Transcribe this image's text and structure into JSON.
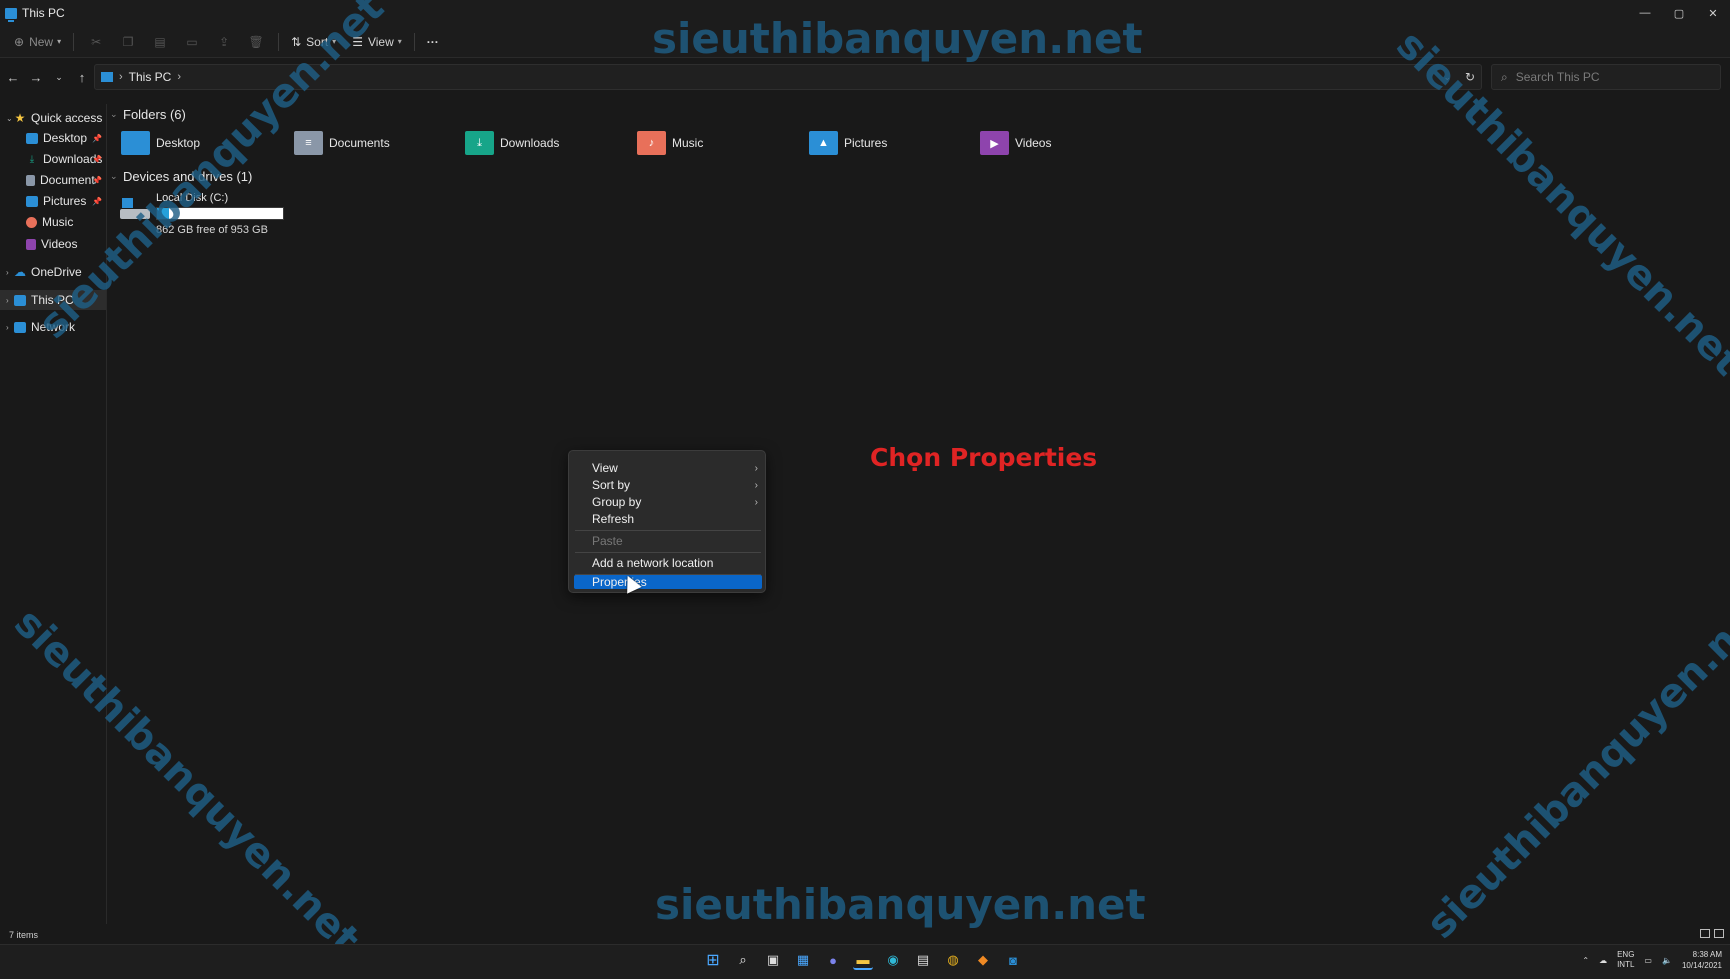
{
  "window": {
    "title": "This PC",
    "controls": {
      "minimize": "—",
      "maximize": "▢",
      "close": "✕"
    }
  },
  "commandbar": {
    "new_label": "New",
    "sort_label": "Sort",
    "view_label": "View",
    "more_label": "···"
  },
  "address": {
    "crumb": "This PC",
    "search_placeholder": "Search This PC"
  },
  "sidebar": {
    "quick_access": "Quick access",
    "items": [
      {
        "label": "Desktop",
        "icon": "desktop-icon",
        "pinned": true
      },
      {
        "label": "Downloads",
        "icon": "downloads-icon",
        "pinned": true
      },
      {
        "label": "Documents",
        "icon": "documents-icon",
        "pinned": true
      },
      {
        "label": "Pictures",
        "icon": "pictures-icon",
        "pinned": true
      },
      {
        "label": "Music",
        "icon": "music-icon",
        "pinned": false
      },
      {
        "label": "Videos",
        "icon": "videos-icon",
        "pinned": false
      }
    ],
    "onedrive": "OneDrive",
    "this_pc": "This PC",
    "network": "Network"
  },
  "content": {
    "folders_header": "Folders (6)",
    "folders": [
      {
        "label": "Desktop",
        "icon": "desktop-folder-icon",
        "color": "#2b8fd6"
      },
      {
        "label": "Documents",
        "icon": "documents-folder-icon",
        "color": "#8a97a8"
      },
      {
        "label": "Downloads",
        "icon": "downloads-folder-icon",
        "color": "#17a589"
      },
      {
        "label": "Music",
        "icon": "music-folder-icon",
        "color": "#e8705a"
      },
      {
        "label": "Pictures",
        "icon": "pictures-folder-icon",
        "color": "#2b8fd6"
      },
      {
        "label": "Videos",
        "icon": "videos-folder-icon",
        "color": "#8e44ad"
      }
    ],
    "drives_header": "Devices and drives (1)",
    "drive": {
      "name": "Local Disk (C:)",
      "free_text": "862 GB free of 953 GB",
      "used_fraction": 0.095
    }
  },
  "context_menu": {
    "view": "View",
    "sort_by": "Sort by",
    "group_by": "Group by",
    "refresh": "Refresh",
    "paste": "Paste",
    "add_network_location": "Add a network location",
    "properties": "Properties"
  },
  "annotation": "Chọn Properties",
  "watermark": "sieuthibanquyen.net",
  "status": {
    "item_count": "7 items"
  },
  "tray": {
    "lang_line1": "ENG",
    "lang_line2": "INTL",
    "time": "8:38 AM",
    "date": "10/14/2021"
  },
  "colors": {
    "accent": "#0a66c9",
    "annotation": "#e02424",
    "watermark": "#1f5f86"
  }
}
